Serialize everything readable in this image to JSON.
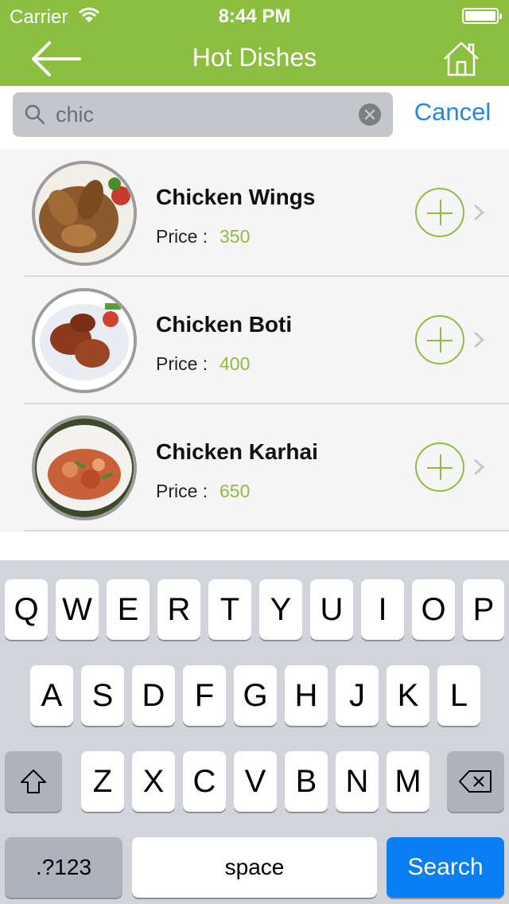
{
  "status_bar": {
    "carrier": "Carrier",
    "time": "8:44 PM"
  },
  "nav": {
    "title": "Hot Dishes",
    "back_icon": "arrow-left-icon",
    "home_icon": "home-icon"
  },
  "search": {
    "value": "chic",
    "cancel_label": "Cancel"
  },
  "dishes": [
    {
      "name": "Chicken Wings",
      "price_label": "Price :",
      "price": "350"
    },
    {
      "name": "Chicken Boti",
      "price_label": "Price :",
      "price": "400"
    },
    {
      "name": "Chicken Karhai",
      "price_label": "Price :",
      "price": "650"
    }
  ],
  "keyboard": {
    "row1": [
      "Q",
      "W",
      "E",
      "R",
      "T",
      "Y",
      "U",
      "I",
      "O",
      "P"
    ],
    "row2": [
      "A",
      "S",
      "D",
      "F",
      "G",
      "H",
      "J",
      "K",
      "L"
    ],
    "row3": [
      "Z",
      "X",
      "C",
      "V",
      "B",
      "N",
      "M"
    ],
    "numbers_label": ".?123",
    "space_label": "space",
    "search_label": "Search"
  },
  "colors": {
    "accent": "#8cbe3f",
    "link": "#1f86ea",
    "search_key": "#0a7ff5"
  }
}
